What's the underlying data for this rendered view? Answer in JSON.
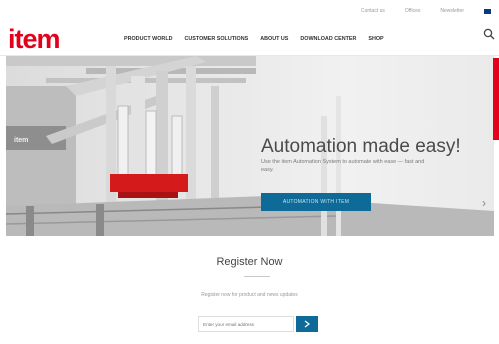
{
  "utility": {
    "items": [
      "Contact us",
      "Offices",
      "Newsletter"
    ],
    "flag_icon": "uk-flag-icon"
  },
  "header": {
    "logo": "item",
    "nav": [
      "PRODUCT WORLD",
      "CUSTOMER SOLUTIONS",
      "ABOUT US",
      "DOWNLOAD CENTER",
      "SHOP"
    ],
    "search_icon": "search-icon"
  },
  "hero": {
    "title": "Automation made easy!",
    "subtitle": "Use the item Automation System to automate with ease — fast and easy.",
    "button": "AUTOMATION WITH ITEM",
    "next_icon": "chevron-right-icon"
  },
  "register": {
    "title": "Register Now",
    "text": "Register now for product and news updates",
    "email_placeholder": "Enter your email address",
    "submit_icon": "arrow-right-icon"
  },
  "colors": {
    "brand_red": "#e2001a",
    "accent_blue": "#0e6a96"
  }
}
